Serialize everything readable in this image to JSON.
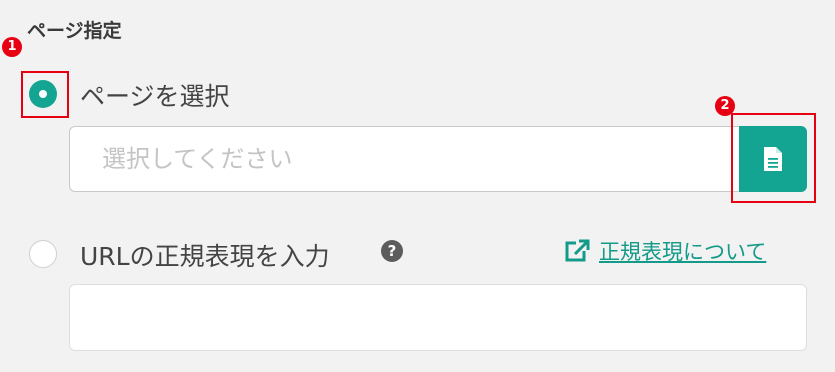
{
  "section_title": "ページ指定",
  "annotations": {
    "badge_1": "1",
    "badge_2": "2",
    "color": "#e60012"
  },
  "accent_color": "#14a592",
  "options": {
    "page": {
      "label": "ページを選択",
      "selected": true
    },
    "url": {
      "label": "URLの正規表現を入力",
      "selected": false
    }
  },
  "page_input": {
    "placeholder": "選択してください",
    "value": ""
  },
  "file_button": {
    "icon": "file-document-icon"
  },
  "help_icon": {
    "icon": "question-circle-icon",
    "glyph": "?"
  },
  "regex_link": {
    "label": "正規表現について",
    "icon": "external-link-icon"
  },
  "url_input": {
    "value": ""
  }
}
